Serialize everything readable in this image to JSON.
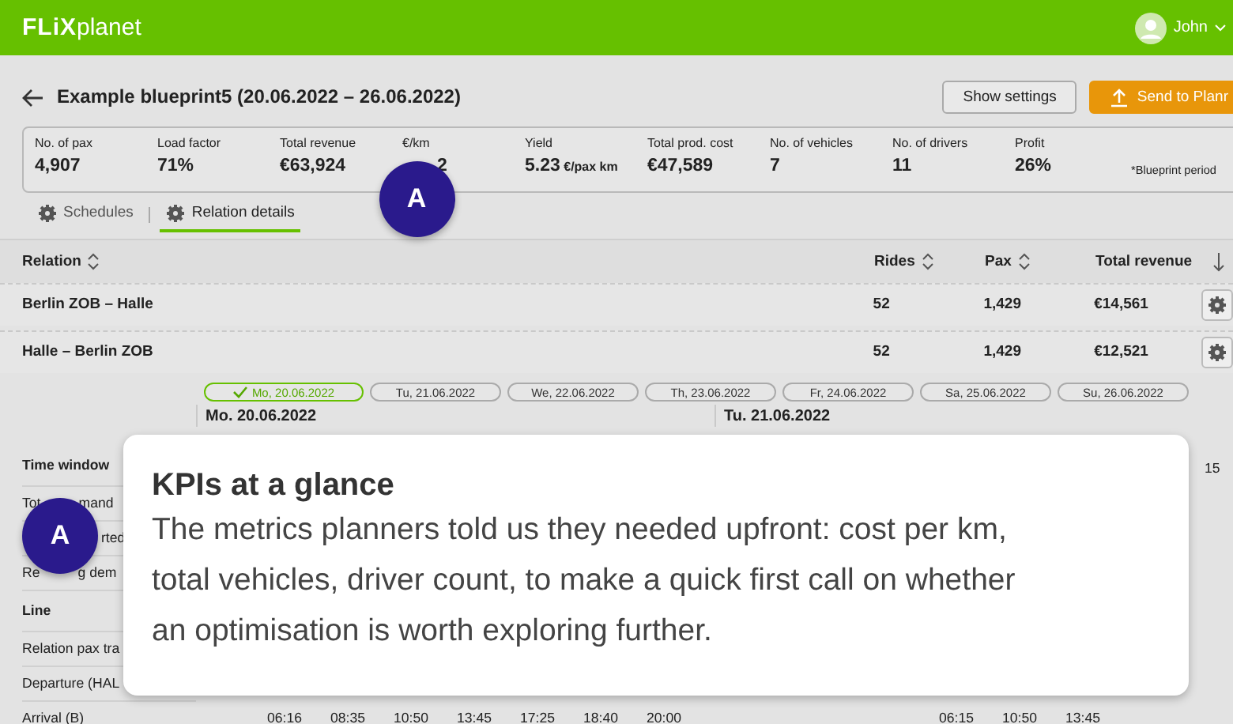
{
  "navbar": {
    "logo_bold": "FLiX",
    "logo_light": "planet",
    "user": "John"
  },
  "header": {
    "title": "Example blueprint5 (20.06.2022 – 26.06.2022)",
    "buttons": [
      {
        "label": "Show settings",
        "kind": "outline"
      },
      {
        "label": "Send to Planr",
        "kind": "primary"
      }
    ]
  },
  "kpis": [
    {
      "label": "No. of pax",
      "value": "4,907"
    },
    {
      "label": "Load factor",
      "value": "71%"
    },
    {
      "label": "Total revenue",
      "value": "€63,924"
    },
    {
      "label": "€/km",
      "value": "2",
      "badge": "A"
    },
    {
      "label": "Yield",
      "value": "5.23",
      "unit": "€/pax km"
    },
    {
      "label": "Total prod. cost",
      "value": "€47,589"
    },
    {
      "label": "No. of vehicles",
      "value": "7"
    },
    {
      "label": "No. of drivers",
      "value": "11"
    },
    {
      "label": "Profit",
      "value": "26%"
    }
  ],
  "kpi_note": "*Blueprint period",
  "tabs": [
    {
      "label": "Schedules",
      "selected": false
    },
    {
      "label": "Relation details",
      "selected": true
    }
  ],
  "table": {
    "columns": [
      {
        "label": "Relation",
        "kind": "sortable"
      },
      {
        "label": "Rides",
        "kind": "sortable"
      },
      {
        "label": "Pax",
        "kind": "sortable"
      },
      {
        "label": "Total revenue",
        "kind": "sorted"
      }
    ],
    "rows": [
      {
        "relation": "Berlin ZOB – Halle",
        "rides": "52",
        "pax": "1,429",
        "revenue": "€14,561"
      },
      {
        "relation": "Halle – Berlin ZOB",
        "rides": "52",
        "pax": "1,429",
        "revenue": "€12,521"
      }
    ]
  },
  "days": [
    {
      "label": "Mo, 20.06.2022",
      "selected": true
    },
    {
      "label": "Tu, 21.06.2022",
      "selected": false
    },
    {
      "label": "We, 22.06.2022",
      "selected": false
    },
    {
      "label": "Th, 23.06.2022",
      "selected": false
    },
    {
      "label": "Fr, 24.06.2022",
      "selected": false
    },
    {
      "label": "Sa, 25.06.2022",
      "selected": false
    },
    {
      "label": "Su, 26.06.2022",
      "selected": false
    }
  ],
  "day_headings": [
    "Mo. 20.06.2022",
    "Tu. 21.06.2022"
  ],
  "detail_labels": [
    {
      "label": "Time window",
      "kind": "heading"
    },
    {
      "label": "Tot",
      "label_after": "mand",
      "kind": "row"
    },
    {
      "label_after": "rted",
      "badge": "A",
      "kind": "row"
    },
    {
      "label": "Re",
      "label_after": "g dem",
      "kind": "row"
    },
    {
      "label": "Line",
      "kind": "heading"
    },
    {
      "label": "Relation pax tra",
      "kind": "row"
    },
    {
      "label": "Departure (HAL",
      "kind": "row"
    }
  ],
  "time_window_fragment": "15",
  "arrival": {
    "label": "Arrival (B)",
    "day1": [
      "06:16",
      "08:35",
      "10:50",
      "13:45",
      "17:25",
      "18:40",
      "20:00"
    ],
    "day2": [
      "06:15",
      "10:50",
      "13:45"
    ]
  },
  "tooltip": {
    "title": "KPIs at a glance",
    "text": "The metrics planners told us they needed upfront: cost per km, total vehicles, driver count, to make a quick first call on whether an optimisation is worth exploring further."
  }
}
